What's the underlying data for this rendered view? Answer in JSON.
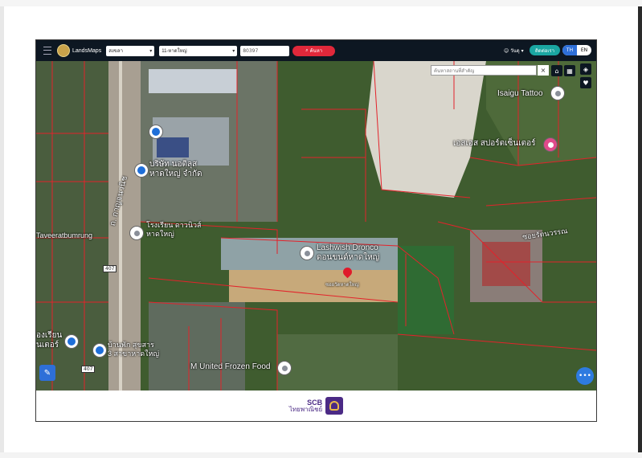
{
  "header": {
    "brand": "LandsMaps",
    "province": "สงขลา",
    "district": "11-หาดใหญ่",
    "parcel_number": "80397",
    "search_label": "ค้นหา",
    "user_name": "วันดุ",
    "contact_label": "ติดต่อเรา",
    "lang_th": "TH",
    "lang_en": "EN"
  },
  "map": {
    "search_placeholder": "ค้นหาสถานที่สำคัญ",
    "close_symbol": "×",
    "labels": {
      "isaigu": "Isaigu Tattoo",
      "sports_center": "เอสเอส สปอร์ตเซ็นเตอร์",
      "company1_line1": "บริษัท นอติลุส",
      "company1_line2": "หาดใหญ่ จำกัด",
      "road_main": "ถ. กาญจนวนิช",
      "veerat": "Taveeratbumrung",
      "school_line1": "โรงเรียน ดาวนิวส์",
      "school_line2": "หาดใหญ่",
      "lashwish_en": "Lashwish Dronco",
      "lashwish_th": "ดอนขนด์หาดใหญ่",
      "alley": "ซอยวัดหาดใหญ่",
      "soi_right": "ซอยรัตนวรรณ",
      "left_line1": "องเรียน",
      "left_line2": "นเตอร์",
      "hospital_line1": "บ้านพัก สุขสาร",
      "hospital_line2": "3 สาขาหาดใหญ่",
      "frozen_food": "M United Frozen Food",
      "route_407_top": "407",
      "route_407_bottom": "407"
    }
  },
  "footer": {
    "brand_en": "SCB",
    "brand_th": "ไทยพาณิชย์"
  },
  "colors": {
    "header_bg": "#0d1722",
    "search_button": "#e0283a",
    "contact_button": "#1aa6a2",
    "lang_active": "#2e6fd8",
    "parcel_lines": "#e3232b",
    "brand_purple": "#4b2a85"
  }
}
